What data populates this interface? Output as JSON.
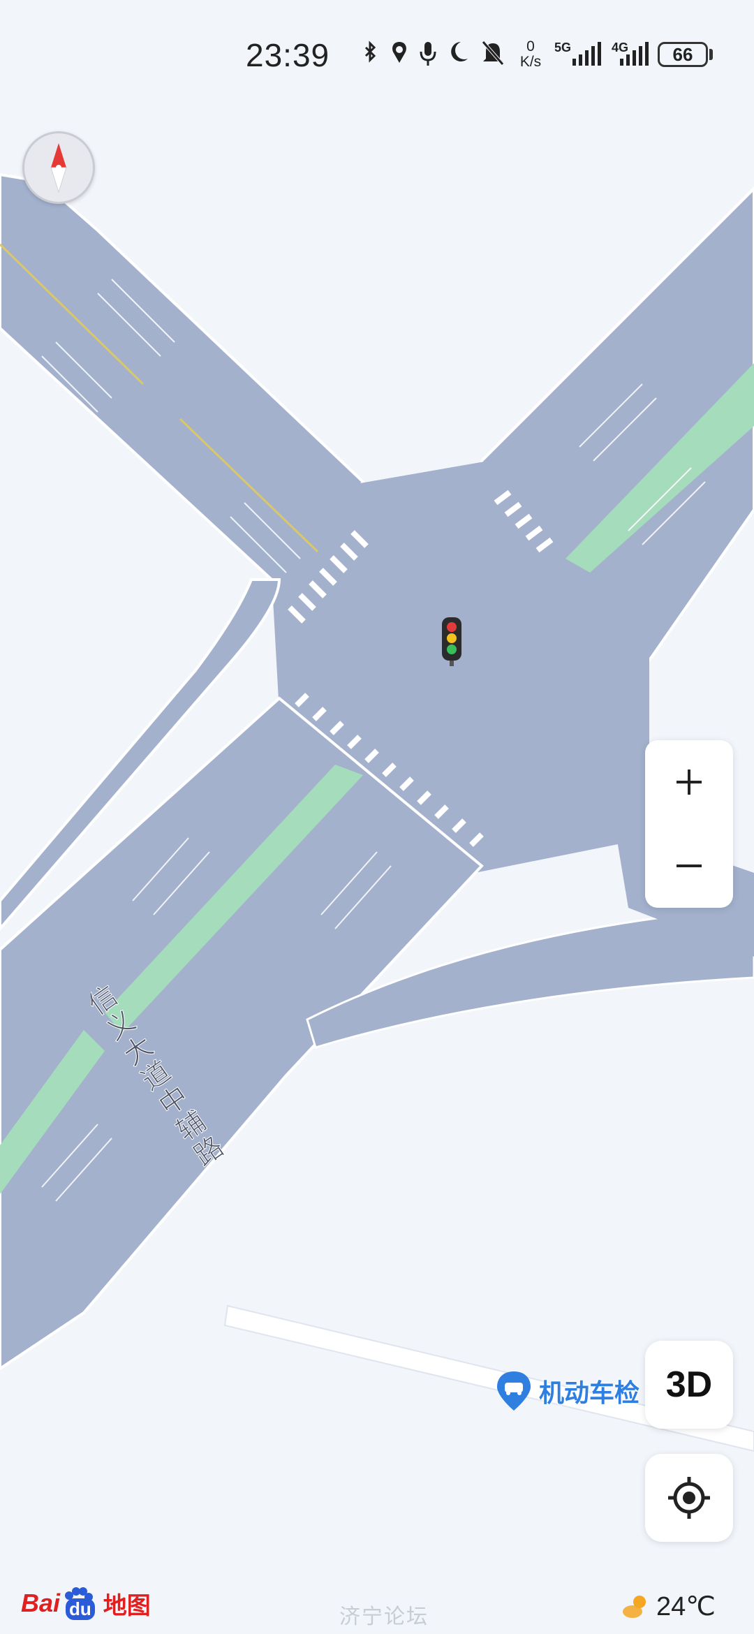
{
  "status_bar": {
    "time": "23:39",
    "net_speed_value": "0",
    "net_speed_unit": "K/s",
    "signal_5g_label": "5G",
    "signal_4g_label": "4G",
    "battery": "66",
    "icons": [
      "bluetooth-icon",
      "location-icon",
      "microphone-icon",
      "moon-icon",
      "bell-off-icon"
    ]
  },
  "map": {
    "road_label": "信义大道中辅路",
    "poi": {
      "label": "机动车检",
      "icon": "car-pin-icon",
      "color": "#2f7fe0"
    },
    "traffic_light_icon": "traffic-light-icon",
    "colors": {
      "road": "#a3b1cd",
      "median": "#a5dcbc",
      "background": "#f2f6fb",
      "centerline": "#d9c86a"
    }
  },
  "controls": {
    "compass_icon": "compass-icon",
    "zoom_in": "+",
    "zoom_out": "−",
    "mode_3d": "3D",
    "locate_icon": "locate-icon"
  },
  "footer": {
    "logo_part1": "Bai",
    "logo_part2": "du",
    "logo_cn": "地图",
    "weather_icon": "partly-cloudy-icon",
    "temperature": "24℃",
    "watermark": "济宁论坛"
  }
}
